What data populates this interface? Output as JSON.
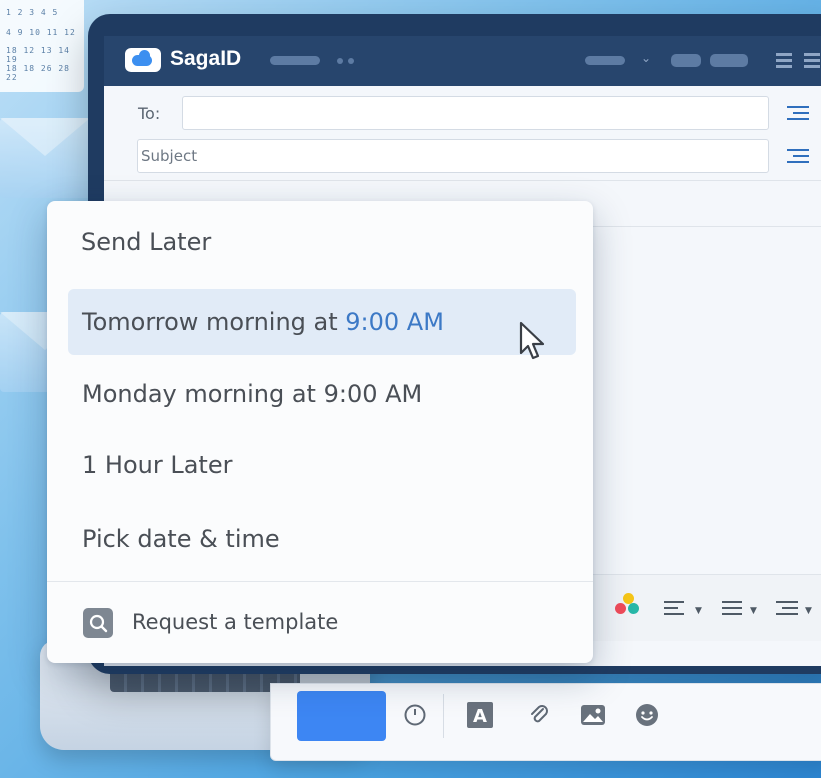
{
  "app": {
    "name": "SagaID"
  },
  "background": {
    "calendar_rows": [
      "1  2  3  4  5",
      "4  9  10 11 12",
      "18 12 13 14 19",
      "18 18 26 28 22"
    ]
  },
  "compose": {
    "to_label": "To:",
    "to_value": "",
    "subject_placeholder": "Subject",
    "subject_value": ""
  },
  "send_later_menu": {
    "title": "Send Later",
    "items": [
      {
        "label_main": "Tomorrow morning at ",
        "label_time": "9:00 AM",
        "highlighted": true
      },
      {
        "label": "Monday morning at 9:00 AM"
      },
      {
        "label": "1 Hour Later"
      },
      {
        "label": "Pick date & time"
      }
    ],
    "footer_action": "Request a template"
  },
  "send_bar": {
    "send_label": "",
    "icons": [
      "clock-icon",
      "text-format-icon",
      "attachment-icon",
      "image-icon",
      "emoji-icon"
    ]
  },
  "colors": {
    "accent": "#3d86f3",
    "titlebar": "#27456d",
    "highlight": "#e1ebf7",
    "time_accent": "#3c79c6"
  }
}
